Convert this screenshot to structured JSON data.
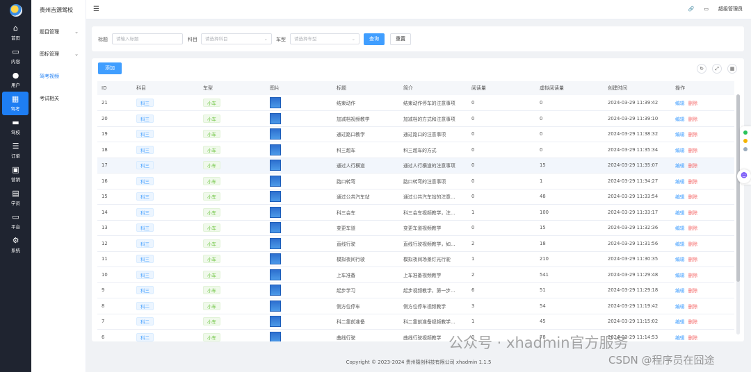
{
  "rail": [
    {
      "icon": "home-icon",
      "glyph": "⌂",
      "label": "首页"
    },
    {
      "icon": "folder-icon",
      "glyph": "▭",
      "label": "内容"
    },
    {
      "icon": "user-icon",
      "glyph": "●",
      "label": "用户"
    },
    {
      "icon": "grid-icon",
      "glyph": "▦",
      "label": "驾考",
      "active": true
    },
    {
      "icon": "car-icon",
      "glyph": "▬",
      "label": "驾校"
    },
    {
      "icon": "list-icon",
      "glyph": "☰",
      "label": "订单"
    },
    {
      "icon": "marketing-icon",
      "glyph": "▣",
      "label": "营销"
    },
    {
      "icon": "student-icon",
      "glyph": "▤",
      "label": "学员"
    },
    {
      "icon": "monitor-icon",
      "glyph": "▭",
      "label": "平台"
    },
    {
      "icon": "gear-icon",
      "glyph": "⚙",
      "label": "系统"
    }
  ],
  "menu": {
    "brand": "贵州吉源驾校",
    "items": [
      {
        "label": "题目管理",
        "chevron": true
      },
      {
        "label": "图标管理",
        "chevron": true
      },
      {
        "label": "驾考视频",
        "active": true
      },
      {
        "label": "考试相关"
      }
    ]
  },
  "topbar": {
    "user": "超级管理员"
  },
  "filter": {
    "title_label": "标题",
    "title_placeholder": "请输入标题",
    "subject_label": "科目",
    "subject_placeholder": "请选择科目",
    "cartype_label": "车型",
    "cartype_placeholder": "请选择车型",
    "search_btn": "查询",
    "reset_btn": "重置"
  },
  "table": {
    "add_btn": "添加",
    "headers": [
      "ID",
      "科目",
      "车型",
      "图片",
      "标题",
      "简介",
      "阅读量",
      "虚拟阅读量",
      "创建时间",
      "操作"
    ],
    "edit": "编辑",
    "delete": "删除",
    "rows": [
      {
        "id": "21",
        "subject": "科三",
        "car": "小车",
        "title": "结束动作",
        "intro": "结束动作停车的注意事项",
        "reads": "0",
        "vreads": "0",
        "time": "2024-03-29 11:39:42"
      },
      {
        "id": "20",
        "subject": "科三",
        "car": "小车",
        "title": "加减档视频教学",
        "intro": "加减档的方式和注意事项",
        "reads": "0",
        "vreads": "0",
        "time": "2024-03-29 11:39:10"
      },
      {
        "id": "19",
        "subject": "科三",
        "car": "小车",
        "title": "通过路口教学",
        "intro": "通过路口的注意事项",
        "reads": "0",
        "vreads": "0",
        "time": "2024-03-29 11:38:32"
      },
      {
        "id": "18",
        "subject": "科三",
        "car": "小车",
        "title": "科三超车",
        "intro": "科三超车的方式",
        "reads": "0",
        "vreads": "0",
        "time": "2024-03-29 11:35:34"
      },
      {
        "id": "17",
        "subject": "科三",
        "car": "小车",
        "title": "通过人行横道",
        "intro": "通过人行横道的注意事项",
        "reads": "0",
        "vreads": "15",
        "time": "2024-03-29 11:35:07",
        "hl": true
      },
      {
        "id": "16",
        "subject": "科三",
        "car": "小车",
        "title": "路口转弯",
        "intro": "路口转弯的注意事项",
        "reads": "0",
        "vreads": "1",
        "time": "2024-03-29 11:34:27"
      },
      {
        "id": "15",
        "subject": "科三",
        "car": "小车",
        "title": "通过公共汽车站",
        "intro": "通过公共汽车站的注意...",
        "reads": "0",
        "vreads": "48",
        "time": "2024-03-29 11:33:54"
      },
      {
        "id": "14",
        "subject": "科三",
        "car": "小车",
        "title": "科三会车",
        "intro": "科三会车视频教学，注...",
        "reads": "1",
        "vreads": "100",
        "time": "2024-03-29 11:33:17"
      },
      {
        "id": "13",
        "subject": "科三",
        "car": "小车",
        "title": "变更车道",
        "intro": "变更车道视频教学",
        "reads": "0",
        "vreads": "15",
        "time": "2024-03-29 11:32:36"
      },
      {
        "id": "12",
        "subject": "科三",
        "car": "小车",
        "title": "直线行驶",
        "intro": "直线行驶视频教学，如...",
        "reads": "2",
        "vreads": "18",
        "time": "2024-03-29 11:31:56"
      },
      {
        "id": "11",
        "subject": "科三",
        "car": "小车",
        "title": "模拟夜间行驶",
        "intro": "模拟夜间场景灯光行驶",
        "reads": "1",
        "vreads": "210",
        "time": "2024-03-29 11:30:35"
      },
      {
        "id": "10",
        "subject": "科三",
        "car": "小车",
        "title": "上车准备",
        "intro": "上车准备视频教学",
        "reads": "2",
        "vreads": "541",
        "time": "2024-03-29 11:29:48"
      },
      {
        "id": "9",
        "subject": "科三",
        "car": "小车",
        "title": "起步学习",
        "intro": "起步视频教学，第一步...",
        "reads": "6",
        "vreads": "51",
        "time": "2024-03-29 11:29:18"
      },
      {
        "id": "8",
        "subject": "科二",
        "car": "小车",
        "title": "侧方位停车",
        "intro": "侧方位停车视频教学",
        "reads": "3",
        "vreads": "54",
        "time": "2024-03-29 11:19:42"
      },
      {
        "id": "7",
        "subject": "科二",
        "car": "小车",
        "title": "科二靠前准备",
        "intro": "科二靠前准备视频教学...",
        "reads": "1",
        "vreads": "45",
        "time": "2024-03-29 11:15:02"
      },
      {
        "id": "6",
        "subject": "科二",
        "car": "小车",
        "title": "曲线行驶",
        "intro": "曲线行驶视频教学",
        "reads": "0",
        "vreads": "78",
        "time": "2024-03-29 11:14:53"
      }
    ]
  },
  "footer": "Copyright © 2023-2024 贵州猿创科技有限公司  xhadmin 1.1.5",
  "watermark": {
    "line1": "公众号 · xhadmin官方服务",
    "line2": "CSDN @程序员在囧途"
  }
}
